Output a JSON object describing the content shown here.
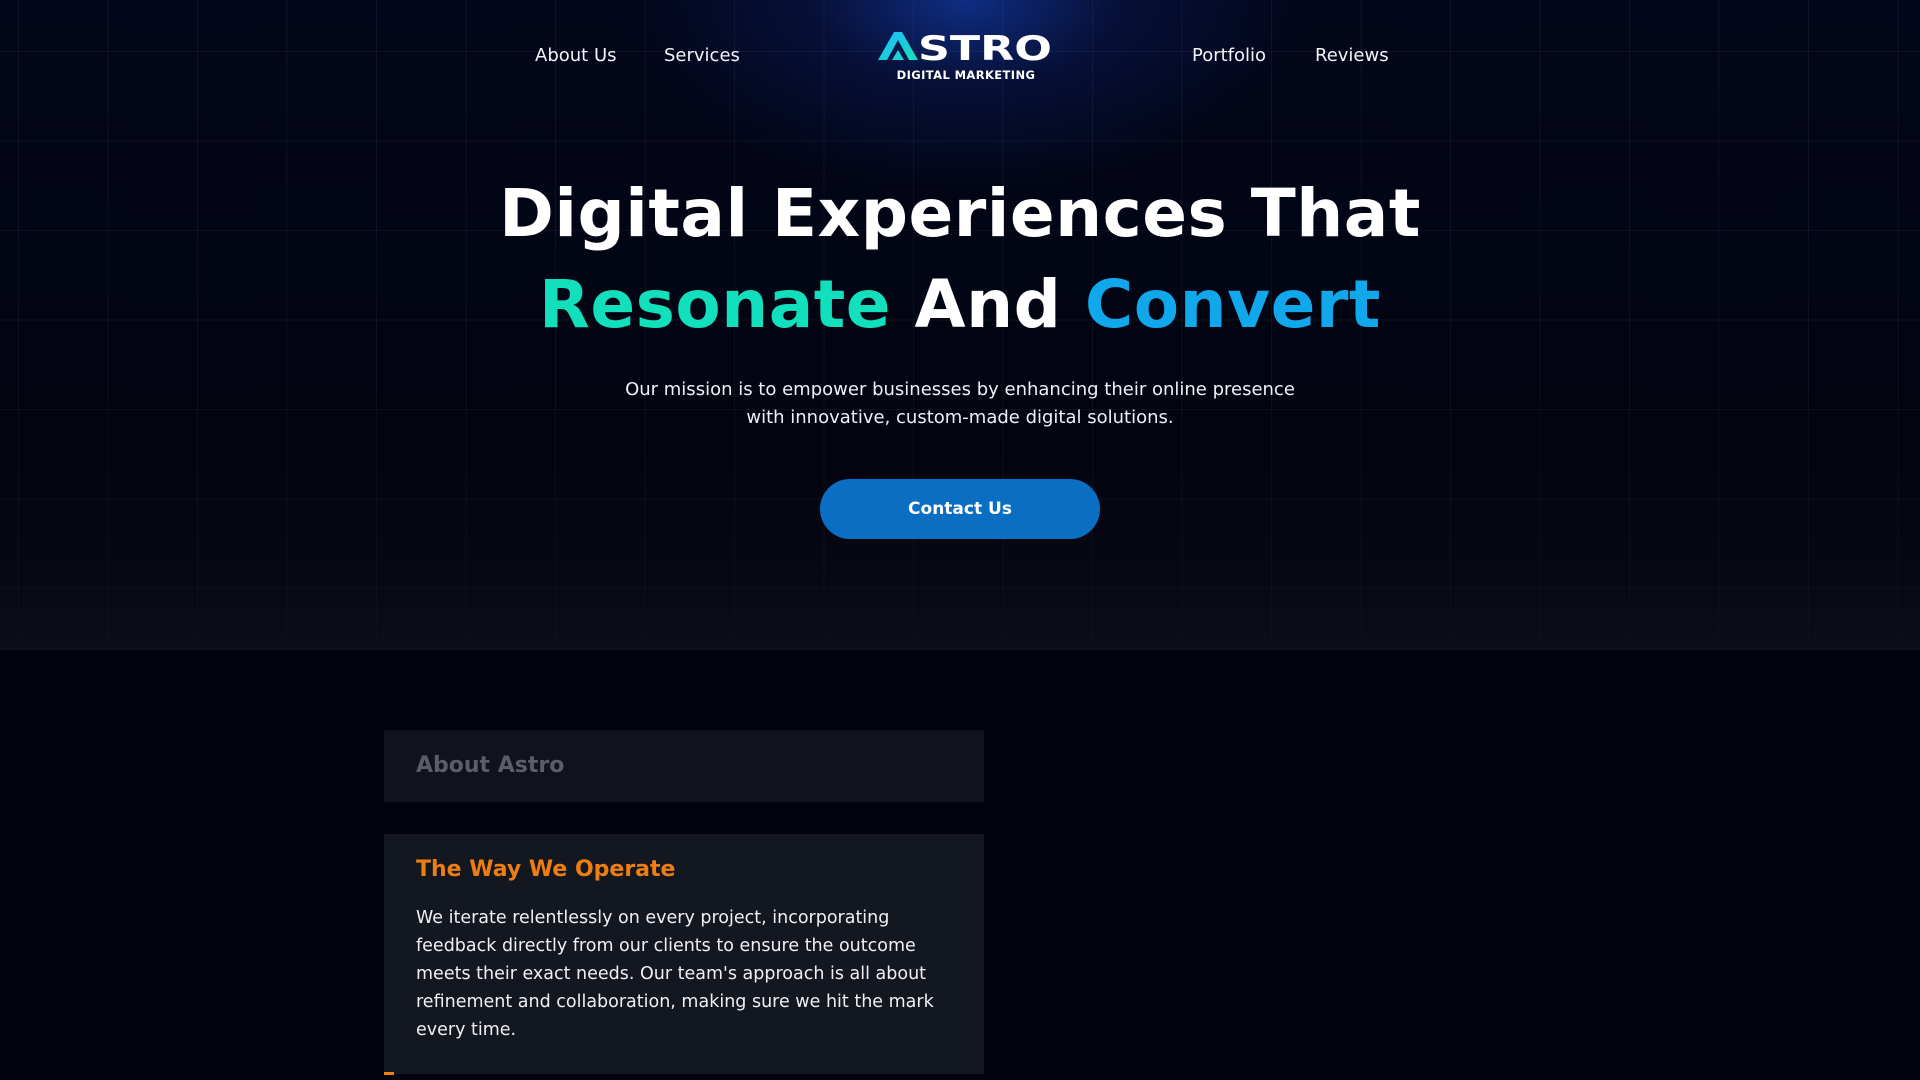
{
  "nav": {
    "left": [
      "About Us",
      "Services"
    ],
    "right": [
      "Portfolio",
      "Reviews"
    ]
  },
  "logo": {
    "wordmark": "ASTRO",
    "subtitle": "DIGITAL MARKETING",
    "colors": {
      "gradient_start": "#1fb8ff",
      "gradient_end": "#14e3b8",
      "text": "#ffffff"
    }
  },
  "hero": {
    "headline_line1": "Digital Experiences That",
    "headline_line2": {
      "word1": "Resonate",
      "word2": "And",
      "word3": "Convert"
    },
    "mission_line1": "Our mission is to empower businesses by enhancing their online presence",
    "mission_line2": "with innovative, custom-made digital solutions.",
    "cta_label": "Contact Us"
  },
  "about": {
    "tab_label": "About Astro",
    "card_title": "The Way We Operate",
    "card_body": "We iterate relentlessly on every project, incorporating feedback directly from our clients to ensure the outcome meets their exact needs. Our team's approach is all about refinement and collaboration, making sure we hit the mark every time."
  },
  "colors": {
    "background": "#02040d",
    "accent_teal": "#12e0bc",
    "accent_blue": "#10a8ea",
    "button": "#0a6fc2",
    "card_title": "#ee7d12",
    "card_bg": "#131820"
  }
}
